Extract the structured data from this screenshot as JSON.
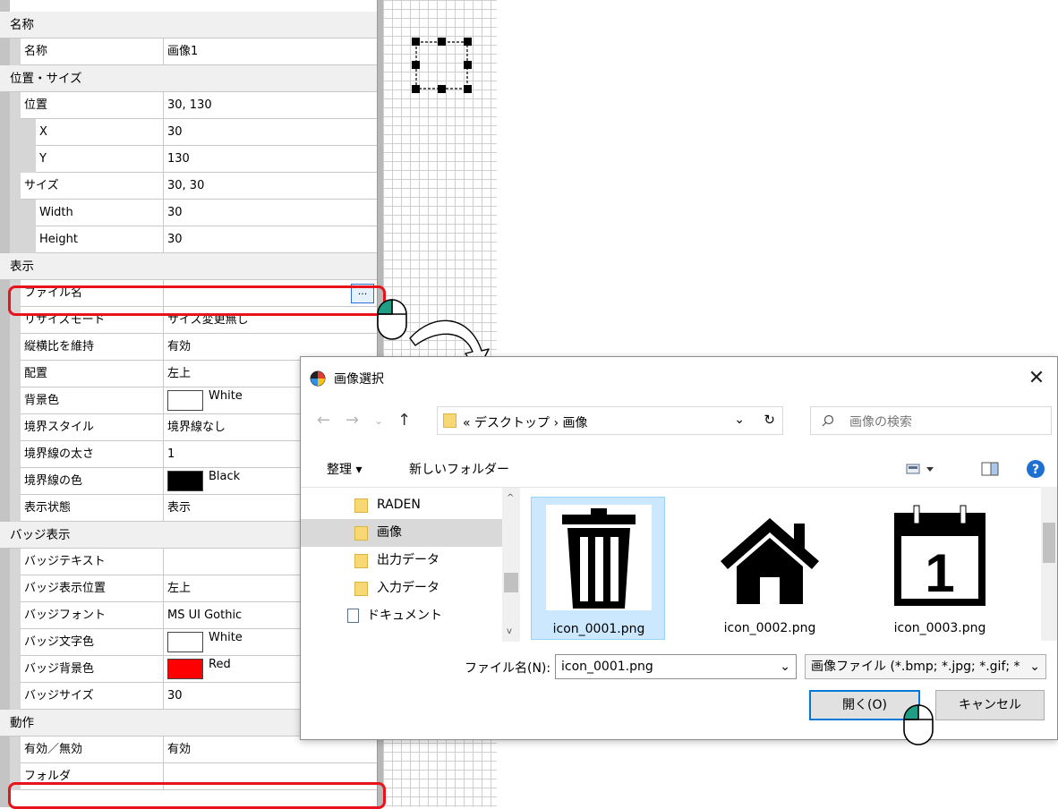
{
  "property_grid": {
    "rows": [
      {
        "kind": "category",
        "label": "名称"
      },
      {
        "kind": "prop",
        "indent": 1,
        "name": "名称",
        "value": "画像1"
      },
      {
        "kind": "category",
        "label": "位置・サイズ"
      },
      {
        "kind": "prop",
        "indent": 1,
        "name": "位置",
        "value": "30, 130"
      },
      {
        "kind": "prop",
        "indent": 2,
        "name": "X",
        "value": "30"
      },
      {
        "kind": "prop",
        "indent": 2,
        "name": "Y",
        "value": "130"
      },
      {
        "kind": "prop",
        "indent": 1,
        "name": "サイズ",
        "value": "30, 30"
      },
      {
        "kind": "prop",
        "indent": 2,
        "name": "Width",
        "value": "30"
      },
      {
        "kind": "prop",
        "indent": 2,
        "name": "Height",
        "value": "30"
      },
      {
        "kind": "category",
        "label": "表示"
      },
      {
        "kind": "prop",
        "indent": 1,
        "name": "ファイル名",
        "value": "",
        "button": "..."
      },
      {
        "kind": "prop",
        "indent": 1,
        "name": "リサイズモード",
        "value": "サイズ変更無し"
      },
      {
        "kind": "prop",
        "indent": 1,
        "name": "縦横比を維持",
        "value": "有効"
      },
      {
        "kind": "prop",
        "indent": 1,
        "name": "配置",
        "value": "左上"
      },
      {
        "kind": "prop",
        "indent": 1,
        "name": "背景色",
        "value": "White",
        "swatch": "#ffffff"
      },
      {
        "kind": "prop",
        "indent": 1,
        "name": "境界スタイル",
        "value": "境界線なし"
      },
      {
        "kind": "prop",
        "indent": 1,
        "name": "境界線の太さ",
        "value": "1"
      },
      {
        "kind": "prop",
        "indent": 1,
        "name": "境界線の色",
        "value": "Black",
        "swatch": "#000000"
      },
      {
        "kind": "prop",
        "indent": 1,
        "name": "表示状態",
        "value": "表示"
      },
      {
        "kind": "category",
        "label": "バッジ表示"
      },
      {
        "kind": "prop",
        "indent": 1,
        "name": "バッジテキスト",
        "value": ""
      },
      {
        "kind": "prop",
        "indent": 1,
        "name": "バッジ表示位置",
        "value": "左上"
      },
      {
        "kind": "prop",
        "indent": 1,
        "name": "バッジフォント",
        "value": "MS UI Gothic"
      },
      {
        "kind": "prop",
        "indent": 1,
        "name": "バッジ文字色",
        "value": "White",
        "swatch": "#ffffff"
      },
      {
        "kind": "prop",
        "indent": 1,
        "name": "バッジ背景色",
        "value": "Red",
        "swatch": "#ff0000"
      },
      {
        "kind": "prop",
        "indent": 1,
        "name": "バッジサイズ",
        "value": "30"
      },
      {
        "kind": "category",
        "label": "動作"
      },
      {
        "kind": "prop",
        "indent": 1,
        "name": "有効／無効",
        "value": "有効"
      },
      {
        "kind": "prop",
        "indent": 1,
        "name": "フォルダ",
        "value": ""
      }
    ]
  },
  "dialog": {
    "title": "画像選択",
    "close": "✕",
    "nav": {
      "back": "←",
      "forward": "→",
      "recent": "⌄",
      "up": "↑"
    },
    "address": "« デスクトップ › 画像",
    "address_dropdown": "⌄",
    "refresh": "↻",
    "search_placeholder": "画像の検索",
    "toolbar": {
      "organize": "整理 ▾",
      "new_folder": "新しいフォルダー",
      "help": "?"
    },
    "folders": [
      {
        "label": "RADEN",
        "selected": false,
        "type": "folder"
      },
      {
        "label": "画像",
        "selected": true,
        "type": "folder"
      },
      {
        "label": "出力データ",
        "selected": false,
        "type": "folder"
      },
      {
        "label": "入力データ",
        "selected": false,
        "type": "folder"
      },
      {
        "label": "ドキュメント",
        "selected": false,
        "type": "documents"
      }
    ],
    "files": [
      {
        "name": "icon_0001.png",
        "icon": "trash-can-icon",
        "selected": true
      },
      {
        "name": "icon_0002.png",
        "icon": "house-icon",
        "selected": false
      },
      {
        "name": "icon_0003.png",
        "icon": "calendar-icon",
        "selected": false
      }
    ],
    "filename_label": "ファイル名(N):",
    "filename_value": "icon_0001.png",
    "filetype_value": "画像ファイル (*.bmp; *.jpg; *.gif; *",
    "open_button": "開く(O)",
    "cancel_button": "キャンセル"
  },
  "colors": {
    "highlight": "#e8141b",
    "selection": "#cce8ff",
    "accent": "#0078d7"
  }
}
